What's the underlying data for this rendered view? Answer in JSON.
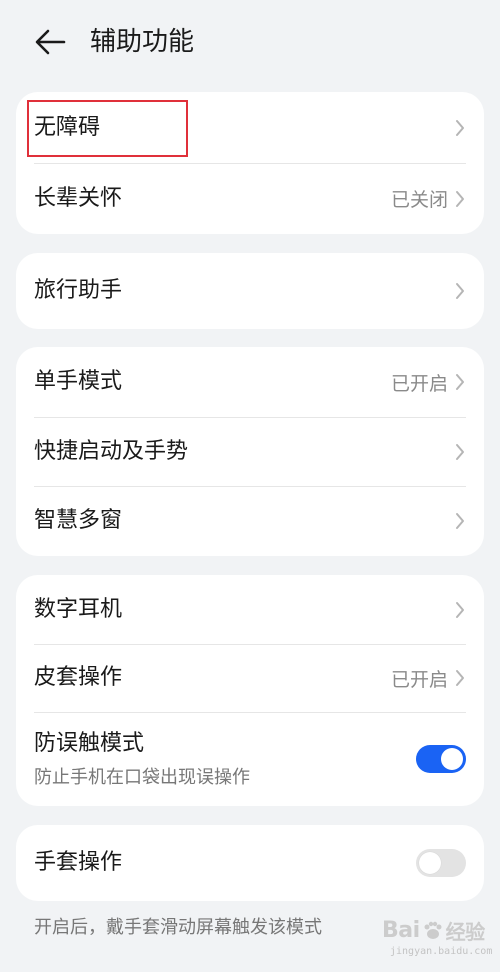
{
  "header": {
    "title": "辅助功能"
  },
  "groups": [
    {
      "items": [
        {
          "label": "无障碍",
          "value": ""
        },
        {
          "label": "长辈关怀",
          "value": "已关闭"
        }
      ]
    },
    {
      "items": [
        {
          "label": "旅行助手",
          "value": ""
        }
      ]
    },
    {
      "items": [
        {
          "label": "单手模式",
          "value": "已开启"
        },
        {
          "label": "快捷启动及手势",
          "value": ""
        },
        {
          "label": "智慧多窗",
          "value": ""
        }
      ]
    },
    {
      "items": [
        {
          "label": "数字耳机",
          "value": ""
        },
        {
          "label": "皮套操作",
          "value": "已开启"
        },
        {
          "label": "防误触模式",
          "sublabel": "防止手机在口袋出现误操作",
          "toggle": "on"
        }
      ]
    },
    {
      "items": [
        {
          "label": "手套操作",
          "toggle": "off"
        }
      ]
    }
  ],
  "footer_note": "开启后，戴手套滑动屏幕触发该模式",
  "watermark": {
    "brand": "Bai",
    "brand2": "经验",
    "url": "jingyan.baidu.com"
  },
  "colors": {
    "toggle_on": "#1a63f4",
    "highlight": "#e0303a"
  }
}
